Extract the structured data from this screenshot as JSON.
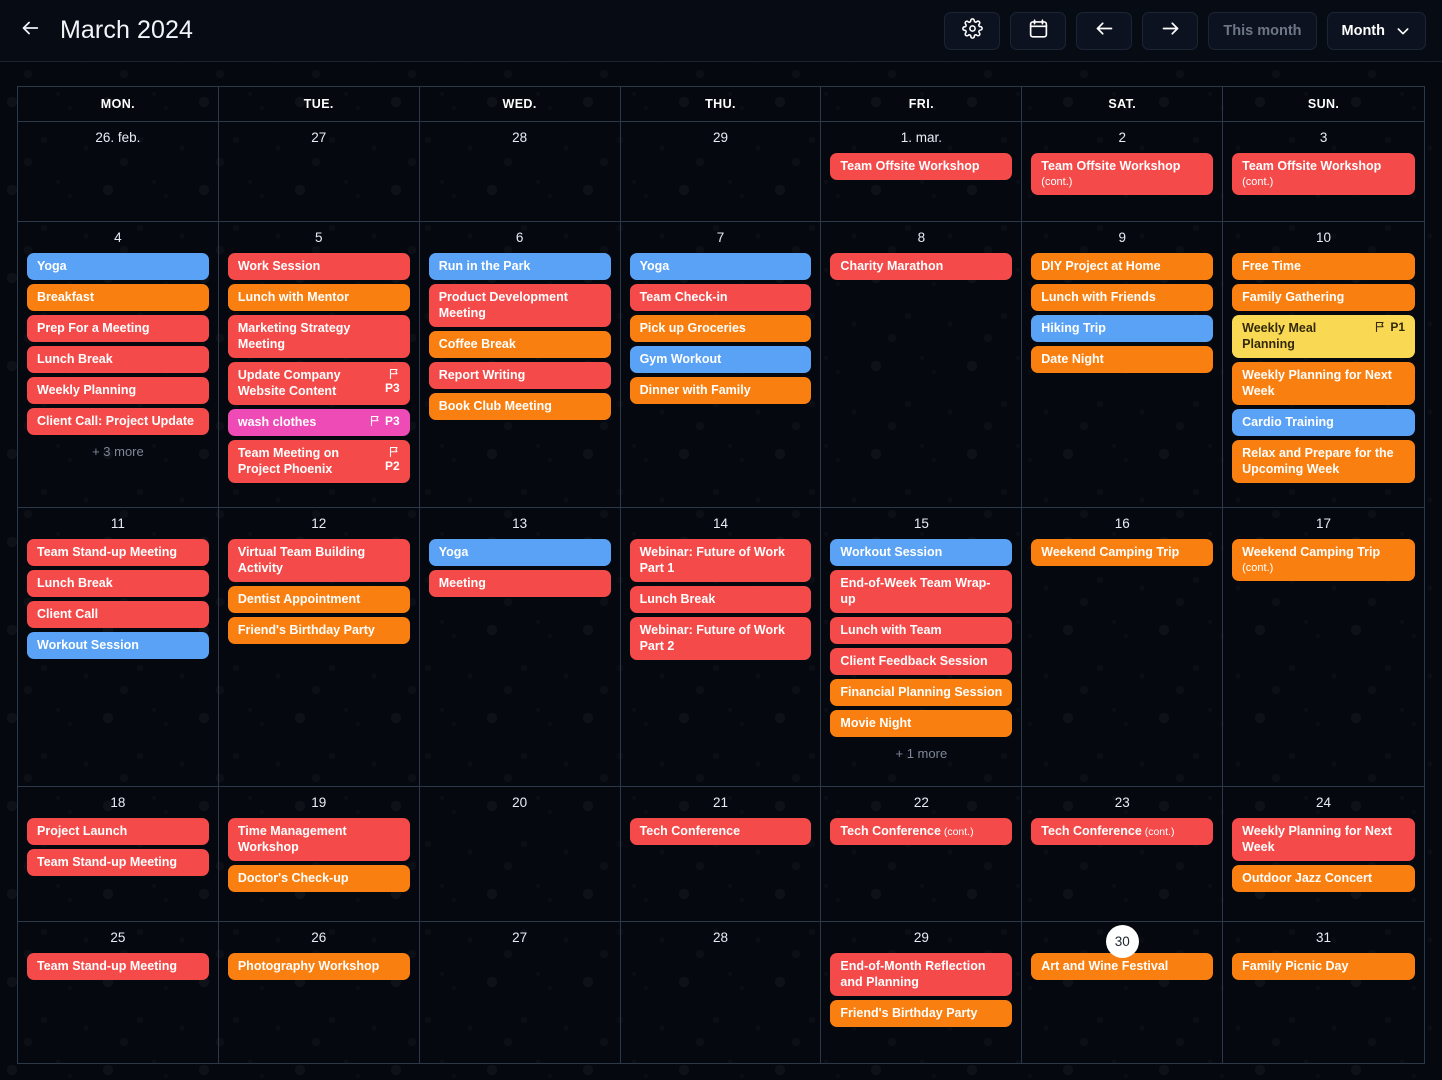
{
  "header": {
    "back_icon": "arrow-left-icon",
    "title": "March 2024",
    "buttons": [
      {
        "name": "settings",
        "icon": "gear-icon",
        "label": ""
      },
      {
        "name": "date-picker",
        "icon": "calendar-icon",
        "label": ""
      },
      {
        "name": "previous",
        "icon": "arrow-left-icon",
        "label": ""
      },
      {
        "name": "next",
        "icon": "arrow-right-icon",
        "label": ""
      }
    ],
    "this_month_label": "This month",
    "view_label": "Month",
    "view_chevron_icon": "chevron-down-icon"
  },
  "weekdays": [
    "MON.",
    "TUE.",
    "WED.",
    "THU.",
    "FRI.",
    "SAT.",
    "SUN."
  ],
  "colors": {
    "red": "#f44a4a",
    "orange": "#f98010",
    "blue": "#5aa2f5",
    "pink": "#ee4bb7",
    "yellow": "#f9d953",
    "background": "#05080f",
    "grid_line": "#2c3747",
    "today_pill": "#ffffff"
  },
  "weeks": [
    {
      "days": [
        {
          "num": "26. feb.",
          "today": false,
          "events": [],
          "more": ""
        },
        {
          "num": "27",
          "today": false,
          "events": [],
          "more": ""
        },
        {
          "num": "28",
          "today": false,
          "events": [],
          "more": ""
        },
        {
          "num": "29",
          "today": false,
          "events": [],
          "more": ""
        },
        {
          "num": "1. mar.",
          "today": false,
          "events": [
            {
              "title": "Team Offsite Workshop",
              "color": "red",
              "cont": "",
              "cont_style": "none",
              "priority": ""
            }
          ],
          "more": ""
        },
        {
          "num": "2",
          "today": false,
          "events": [
            {
              "title": "Team Offsite Workshop",
              "color": "red",
              "cont": "(cont.)",
              "cont_style": "block",
              "priority": ""
            }
          ],
          "more": ""
        },
        {
          "num": "3",
          "today": false,
          "events": [
            {
              "title": "Team Offsite Workshop",
              "color": "red",
              "cont": "(cont.)",
              "cont_style": "block",
              "priority": ""
            }
          ],
          "more": ""
        }
      ]
    },
    {
      "days": [
        {
          "num": "4",
          "today": false,
          "more": "+ 3 more",
          "events": [
            {
              "title": "Yoga",
              "color": "blue",
              "cont": "",
              "cont_style": "none",
              "priority": ""
            },
            {
              "title": "Breakfast",
              "color": "orange",
              "cont": "",
              "cont_style": "none",
              "priority": ""
            },
            {
              "title": "Prep For a Meeting",
              "color": "red",
              "cont": "",
              "cont_style": "none",
              "priority": ""
            },
            {
              "title": "Lunch Break",
              "color": "red",
              "cont": "",
              "cont_style": "none",
              "priority": ""
            },
            {
              "title": "Weekly Planning",
              "color": "red",
              "cont": "",
              "cont_style": "none",
              "priority": ""
            },
            {
              "title": "Client Call: Project Update",
              "color": "red",
              "cont": "",
              "cont_style": "none",
              "priority": ""
            }
          ]
        },
        {
          "num": "5",
          "today": false,
          "more": "",
          "events": [
            {
              "title": "Work Session",
              "color": "red",
              "cont": "",
              "cont_style": "none",
              "priority": ""
            },
            {
              "title": "Lunch with Mentor",
              "color": "orange",
              "cont": "",
              "cont_style": "none",
              "priority": ""
            },
            {
              "title": "Marketing Strategy Meeting",
              "color": "red",
              "cont": "",
              "cont_style": "none",
              "priority": ""
            },
            {
              "title": "Update Company Website Content",
              "color": "red",
              "cont": "",
              "cont_style": "none",
              "priority": "P3",
              "priority_layout": "stacked"
            },
            {
              "title": "wash clothes",
              "color": "pink",
              "cont": "",
              "cont_style": "none",
              "priority": "P3",
              "priority_layout": "inline"
            },
            {
              "title": "Team Meeting on Project Phoenix",
              "color": "red",
              "cont": "",
              "cont_style": "none",
              "priority": "P2",
              "priority_layout": "stacked"
            }
          ]
        },
        {
          "num": "6",
          "today": false,
          "more": "",
          "events": [
            {
              "title": "Run in the Park",
              "color": "blue",
              "cont": "",
              "cont_style": "none",
              "priority": ""
            },
            {
              "title": "Product Development Meeting",
              "color": "red",
              "cont": "",
              "cont_style": "none",
              "priority": ""
            },
            {
              "title": "Coffee Break",
              "color": "orange",
              "cont": "",
              "cont_style": "none",
              "priority": ""
            },
            {
              "title": "Report Writing",
              "color": "red",
              "cont": "",
              "cont_style": "none",
              "priority": ""
            },
            {
              "title": "Book Club Meeting",
              "color": "orange",
              "cont": "",
              "cont_style": "none",
              "priority": ""
            }
          ]
        },
        {
          "num": "7",
          "today": false,
          "more": "",
          "events": [
            {
              "title": "Yoga",
              "color": "blue",
              "cont": "",
              "cont_style": "none",
              "priority": ""
            },
            {
              "title": "Team Check-in",
              "color": "red",
              "cont": "",
              "cont_style": "none",
              "priority": ""
            },
            {
              "title": "Pick up Groceries",
              "color": "orange",
              "cont": "",
              "cont_style": "none",
              "priority": ""
            },
            {
              "title": "Gym Workout",
              "color": "blue",
              "cont": "",
              "cont_style": "none",
              "priority": ""
            },
            {
              "title": "Dinner with Family",
              "color": "orange",
              "cont": "",
              "cont_style": "none",
              "priority": ""
            }
          ]
        },
        {
          "num": "8",
          "today": false,
          "more": "",
          "events": [
            {
              "title": "Charity Marathon",
              "color": "red",
              "cont": "",
              "cont_style": "none",
              "priority": ""
            }
          ]
        },
        {
          "num": "9",
          "today": false,
          "more": "",
          "events": [
            {
              "title": "DIY Project at Home",
              "color": "orange",
              "cont": "",
              "cont_style": "none",
              "priority": ""
            },
            {
              "title": "Lunch with Friends",
              "color": "orange",
              "cont": "",
              "cont_style": "none",
              "priority": ""
            },
            {
              "title": "Hiking Trip",
              "color": "blue",
              "cont": "",
              "cont_style": "none",
              "priority": ""
            },
            {
              "title": "Date Night",
              "color": "orange",
              "cont": "",
              "cont_style": "none",
              "priority": ""
            }
          ]
        },
        {
          "num": "10",
          "today": false,
          "more": "",
          "events": [
            {
              "title": "Free Time",
              "color": "orange",
              "cont": "",
              "cont_style": "none",
              "priority": ""
            },
            {
              "title": "Family Gathering",
              "color": "orange",
              "cont": "",
              "cont_style": "none",
              "priority": ""
            },
            {
              "title": "Weekly Meal Planning",
              "color": "yellow",
              "cont": "",
              "cont_style": "none",
              "priority": "P1",
              "priority_layout": "inline"
            },
            {
              "title": "Weekly Planning for Next Week",
              "color": "orange",
              "cont": "",
              "cont_style": "none",
              "priority": ""
            },
            {
              "title": "Cardio Training",
              "color": "blue",
              "cont": "",
              "cont_style": "none",
              "priority": ""
            },
            {
              "title": "Relax and Prepare for the Upcoming Week",
              "color": "orange",
              "cont": "",
              "cont_style": "none",
              "priority": ""
            }
          ]
        }
      ]
    },
    {
      "days": [
        {
          "num": "11",
          "today": false,
          "more": "",
          "events": [
            {
              "title": "Team Stand-up Meeting",
              "color": "red",
              "cont": "",
              "cont_style": "none",
              "priority": ""
            },
            {
              "title": "Lunch Break",
              "color": "red",
              "cont": "",
              "cont_style": "none",
              "priority": ""
            },
            {
              "title": "Client Call",
              "color": "red",
              "cont": "",
              "cont_style": "none",
              "priority": ""
            },
            {
              "title": "Workout Session",
              "color": "blue",
              "cont": "",
              "cont_style": "none",
              "priority": ""
            }
          ]
        },
        {
          "num": "12",
          "today": false,
          "more": "",
          "events": [
            {
              "title": "Virtual Team Building Activity",
              "color": "red",
              "cont": "",
              "cont_style": "none",
              "priority": ""
            },
            {
              "title": "Dentist Appointment",
              "color": "orange",
              "cont": "",
              "cont_style": "none",
              "priority": ""
            },
            {
              "title": "Friend's Birthday Party",
              "color": "orange",
              "cont": "",
              "cont_style": "none",
              "priority": ""
            }
          ]
        },
        {
          "num": "13",
          "today": false,
          "more": "",
          "events": [
            {
              "title": "Yoga",
              "color": "blue",
              "cont": "",
              "cont_style": "none",
              "priority": ""
            },
            {
              "title": "Meeting",
              "color": "red",
              "cont": "",
              "cont_style": "none",
              "priority": ""
            }
          ]
        },
        {
          "num": "14",
          "today": false,
          "more": "",
          "events": [
            {
              "title": "Webinar: Future of Work Part 1",
              "color": "red",
              "cont": "",
              "cont_style": "none",
              "priority": ""
            },
            {
              "title": "Lunch Break",
              "color": "red",
              "cont": "",
              "cont_style": "none",
              "priority": ""
            },
            {
              "title": "Webinar: Future of Work Part 2",
              "color": "red",
              "cont": "",
              "cont_style": "none",
              "priority": ""
            }
          ]
        },
        {
          "num": "15",
          "today": false,
          "more": "+ 1 more",
          "events": [
            {
              "title": "Workout Session",
              "color": "blue",
              "cont": "",
              "cont_style": "none",
              "priority": ""
            },
            {
              "title": "End-of-Week Team Wrap-up",
              "color": "red",
              "cont": "",
              "cont_style": "none",
              "priority": ""
            },
            {
              "title": "Lunch with Team",
              "color": "red",
              "cont": "",
              "cont_style": "none",
              "priority": ""
            },
            {
              "title": "Client Feedback Session",
              "color": "red",
              "cont": "",
              "cont_style": "none",
              "priority": ""
            },
            {
              "title": "Financial Planning Session",
              "color": "orange",
              "cont": "",
              "cont_style": "none",
              "priority": ""
            },
            {
              "title": "Movie Night",
              "color": "orange",
              "cont": "",
              "cont_style": "none",
              "priority": ""
            }
          ]
        },
        {
          "num": "16",
          "today": false,
          "more": "",
          "events": [
            {
              "title": "Weekend Camping Trip",
              "color": "orange",
              "cont": "",
              "cont_style": "none",
              "priority": ""
            }
          ]
        },
        {
          "num": "17",
          "today": false,
          "more": "",
          "events": [
            {
              "title": "Weekend Camping Trip",
              "color": "orange",
              "cont": "(cont.)",
              "cont_style": "block",
              "priority": ""
            }
          ]
        }
      ]
    },
    {
      "days": [
        {
          "num": "18",
          "today": false,
          "more": "",
          "events": [
            {
              "title": "Project Launch",
              "color": "red",
              "cont": "",
              "cont_style": "none",
              "priority": ""
            },
            {
              "title": "Team Stand-up Meeting",
              "color": "red",
              "cont": "",
              "cont_style": "none",
              "priority": ""
            }
          ]
        },
        {
          "num": "19",
          "today": false,
          "more": "",
          "events": [
            {
              "title": "Time Management Workshop",
              "color": "red",
              "cont": "",
              "cont_style": "none",
              "priority": ""
            },
            {
              "title": "Doctor's Check-up",
              "color": "orange",
              "cont": "",
              "cont_style": "none",
              "priority": ""
            }
          ]
        },
        {
          "num": "20",
          "today": false,
          "more": "",
          "events": []
        },
        {
          "num": "21",
          "today": false,
          "more": "",
          "events": [
            {
              "title": "Tech Conference",
              "color": "red",
              "cont": "",
              "cont_style": "none",
              "priority": ""
            }
          ]
        },
        {
          "num": "22",
          "today": false,
          "more": "",
          "events": [
            {
              "title": "Tech Conference",
              "color": "red",
              "cont": "(cont.)",
              "cont_style": "inline",
              "priority": ""
            }
          ]
        },
        {
          "num": "23",
          "today": false,
          "more": "",
          "events": [
            {
              "title": "Tech Conference",
              "color": "red",
              "cont": "(cont.)",
              "cont_style": "inline",
              "priority": ""
            }
          ]
        },
        {
          "num": "24",
          "today": false,
          "more": "",
          "events": [
            {
              "title": "Weekly Planning for Next Week",
              "color": "red",
              "cont": "",
              "cont_style": "none",
              "priority": ""
            },
            {
              "title": "Outdoor Jazz Concert",
              "color": "orange",
              "cont": "",
              "cont_style": "none",
              "priority": ""
            }
          ]
        }
      ]
    },
    {
      "days": [
        {
          "num": "25",
          "today": false,
          "more": "",
          "events": [
            {
              "title": "Team Stand-up Meeting",
              "color": "red",
              "cont": "",
              "cont_style": "none",
              "priority": ""
            }
          ]
        },
        {
          "num": "26",
          "today": false,
          "more": "",
          "events": [
            {
              "title": "Photography Workshop",
              "color": "orange",
              "cont": "",
              "cont_style": "none",
              "priority": ""
            }
          ]
        },
        {
          "num": "27",
          "today": false,
          "more": "",
          "events": []
        },
        {
          "num": "28",
          "today": false,
          "more": "",
          "events": []
        },
        {
          "num": "29",
          "today": false,
          "more": "",
          "events": [
            {
              "title": "End-of-Month Reflection and Planning",
              "color": "red",
              "cont": "",
              "cont_style": "none",
              "priority": ""
            },
            {
              "title": "Friend's Birthday Party",
              "color": "orange",
              "cont": "",
              "cont_style": "none",
              "priority": ""
            }
          ]
        },
        {
          "num": "30",
          "today": true,
          "more": "",
          "events": [
            {
              "title": "Art and Wine Festival",
              "color": "orange",
              "cont": "",
              "cont_style": "none",
              "priority": ""
            }
          ]
        },
        {
          "num": "31",
          "today": false,
          "more": "",
          "events": [
            {
              "title": "Family Picnic Day",
              "color": "orange",
              "cont": "",
              "cont_style": "none",
              "priority": ""
            }
          ]
        }
      ]
    }
  ]
}
